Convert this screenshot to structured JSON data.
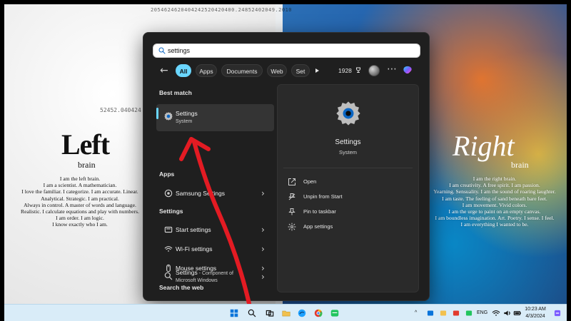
{
  "wallpaper": {
    "digits_top": "2054624620404242520420400.24852402049.2010",
    "digits_left": "52452.040424",
    "left": {
      "title": "Left",
      "subtitle": "brain",
      "lines": [
        "I am the left brain.",
        "I am a scientist. A mathematician.",
        "I love the familiar. I categorize. I am accurate. Linear.",
        "Analytical. Strategic. I am practical.",
        "Always in control. A master of words and language.",
        "Realistic. I calculate equations and play with numbers.",
        "I am order. I am logic.",
        "I know exactly who I am."
      ]
    },
    "right": {
      "title": "Right",
      "subtitle": "brain",
      "lines": [
        "I am the right brain.",
        "I am creativity. A free spirit. I am passion.",
        "Yearning. Sensuality. I am the sound of roaring laughter.",
        "I am taste. The feeling of sand beneath bare feet.",
        "I am movement. Vivid colors.",
        "I am the urge to paint on an empty canvas.",
        "I am boundless imagination. Art. Poetry. I sense. I feel.",
        "I am everything I wanted to be."
      ]
    }
  },
  "start_menu": {
    "search": {
      "value": "settings",
      "placeholder": ""
    },
    "filters": {
      "tabs": [
        "All",
        "Apps",
        "Documents",
        "Web",
        "Set"
      ],
      "active_index": 0,
      "points": "1928"
    },
    "results": {
      "best_match_title": "Best match",
      "best_match": {
        "title": "Settings",
        "subtitle": "System"
      },
      "apps_title": "Apps",
      "apps": [
        {
          "title": "Samsung Settings"
        }
      ],
      "settings_title": "Settings",
      "settings": [
        {
          "title": "Start settings"
        },
        {
          "title": "Wi-Fi settings"
        },
        {
          "title": "Mouse settings"
        }
      ],
      "web_title": "Search the web",
      "web": {
        "title": "Settings",
        "subtitle_inline": " - Component of",
        "subtitle": "Microsoft Windows"
      }
    },
    "details": {
      "title": "Settings",
      "subtitle": "System",
      "actions": [
        "Open",
        "Unpin from Start",
        "Pin to taskbar",
        "App settings"
      ]
    }
  },
  "taskbar": {
    "tray": {
      "lang": "ENG"
    },
    "clock": {
      "time": "10:23 AM",
      "date": "4/3/2024"
    }
  },
  "colors": {
    "accent": "#6ad6ff",
    "start_bg": "#1f1f1f",
    "panel_bg": "#2a2a2a",
    "arrow": "#e31b23",
    "taskbar_bg": "#d9ecf8"
  }
}
